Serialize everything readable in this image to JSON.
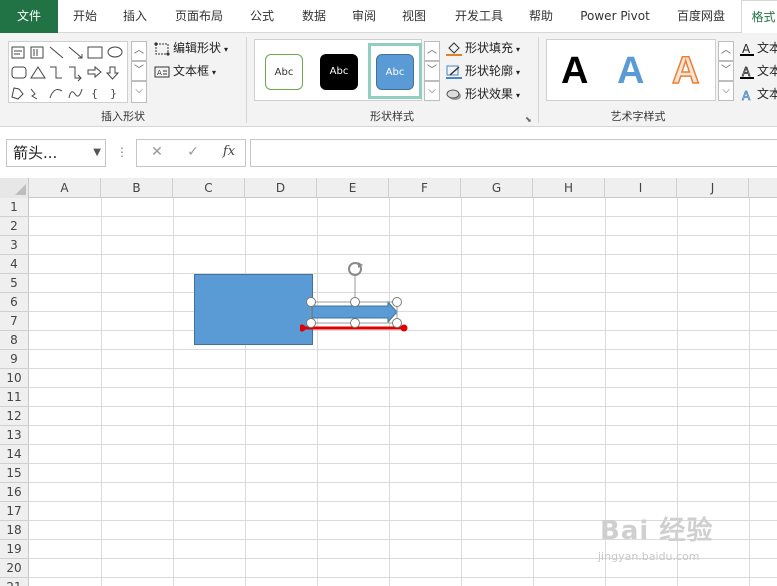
{
  "tabs": {
    "file": "文件",
    "items": [
      "开始",
      "插入",
      "页面布局",
      "公式",
      "数据",
      "审阅",
      "视图",
      "开发工具",
      "帮助",
      "Power Pivot",
      "百度网盘"
    ],
    "active": "格式"
  },
  "ribbon": {
    "insert_shapes": {
      "label": "插入形状",
      "edit_shape": "编辑形状",
      "text_box": "文本框"
    },
    "shape_styles": {
      "label": "形状样式",
      "swatch_text": "Abc",
      "fill": "形状填充",
      "outline": "形状轮廓",
      "effects": "形状效果"
    },
    "wordart": {
      "label": "艺术字样式",
      "letter": "A",
      "text_fill": "文本",
      "text_outline": "文本",
      "text_effects": "文本"
    }
  },
  "formula_bar": {
    "name_box": "箭头...",
    "cancel": "✕",
    "enter": "✓",
    "fx": "fx",
    "value": ""
  },
  "grid": {
    "columns": [
      "A",
      "B",
      "C",
      "D",
      "E",
      "F",
      "G",
      "H",
      "I",
      "J"
    ],
    "rows": [
      "1",
      "2",
      "3",
      "4",
      "5",
      "6",
      "7",
      "8",
      "9",
      "10",
      "11",
      "12",
      "13",
      "14",
      "15",
      "16",
      "17",
      "18",
      "19",
      "20",
      "21"
    ]
  },
  "colors": {
    "excel_green": "#217346",
    "shape_blue": "#5b9bd5",
    "connector_red": "#e00000",
    "selection_frame": "#8fcfbf"
  },
  "watermark": {
    "logo": "Bai 经验",
    "url": "jingyan.baidu.com"
  }
}
